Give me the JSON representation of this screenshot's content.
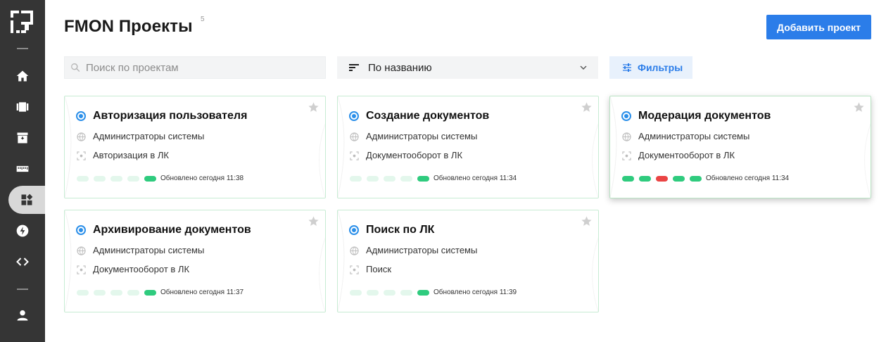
{
  "header": {
    "title": "FMON Проекты",
    "count": "5",
    "add_button": "Добавить проект"
  },
  "toolbar": {
    "search_placeholder": "Поиск по проектам",
    "sort_label": "По названию",
    "filters_label": "Фильтры"
  },
  "sidebar": {
    "items": [
      {
        "icon": "home-icon"
      },
      {
        "icon": "dashboards-icon"
      },
      {
        "icon": "archive-icon"
      },
      {
        "icon": "ruler-icon"
      },
      {
        "icon": "projects-grid-icon",
        "active": true
      },
      {
        "icon": "flash-icon"
      },
      {
        "icon": "code-icon"
      },
      {
        "icon": "user-icon"
      }
    ]
  },
  "colors": {
    "accent": "#2b7de9",
    "ok": "#2fcb7e",
    "error": "#ea4444",
    "sidebar": "#353535"
  },
  "projects": [
    {
      "name": "Авторизация пользователя",
      "group": "Администраторы системы",
      "scenario": "Авторизация в ЛК",
      "statuses": [
        "empty",
        "empty",
        "empty",
        "empty",
        "ok"
      ],
      "updated": "Обновлено сегодня 11:38"
    },
    {
      "name": "Создание документов",
      "group": "Администраторы системы",
      "scenario": "Документооборот в ЛК",
      "statuses": [
        "empty",
        "empty",
        "empty",
        "empty",
        "ok"
      ],
      "updated": "Обновлено сегодня 11:34"
    },
    {
      "name": "Модерация документов",
      "group": "Администраторы системы",
      "scenario": "Документооборот в ЛК",
      "statuses": [
        "ok",
        "ok",
        "error",
        "ok",
        "ok"
      ],
      "updated": "Обновлено сегодня 11:34"
    },
    {
      "name": "Архивирование документов",
      "group": "Администраторы системы",
      "scenario": "Документооборот в ЛК",
      "statuses": [
        "empty",
        "empty",
        "empty",
        "empty",
        "ok"
      ],
      "updated": "Обновлено сегодня 11:37"
    },
    {
      "name": "Поиск по ЛК",
      "group": "Администраторы системы",
      "scenario": "Поиск",
      "statuses": [
        "empty",
        "empty",
        "empty",
        "empty",
        "ok"
      ],
      "updated": "Обновлено сегодня 11:39"
    }
  ]
}
